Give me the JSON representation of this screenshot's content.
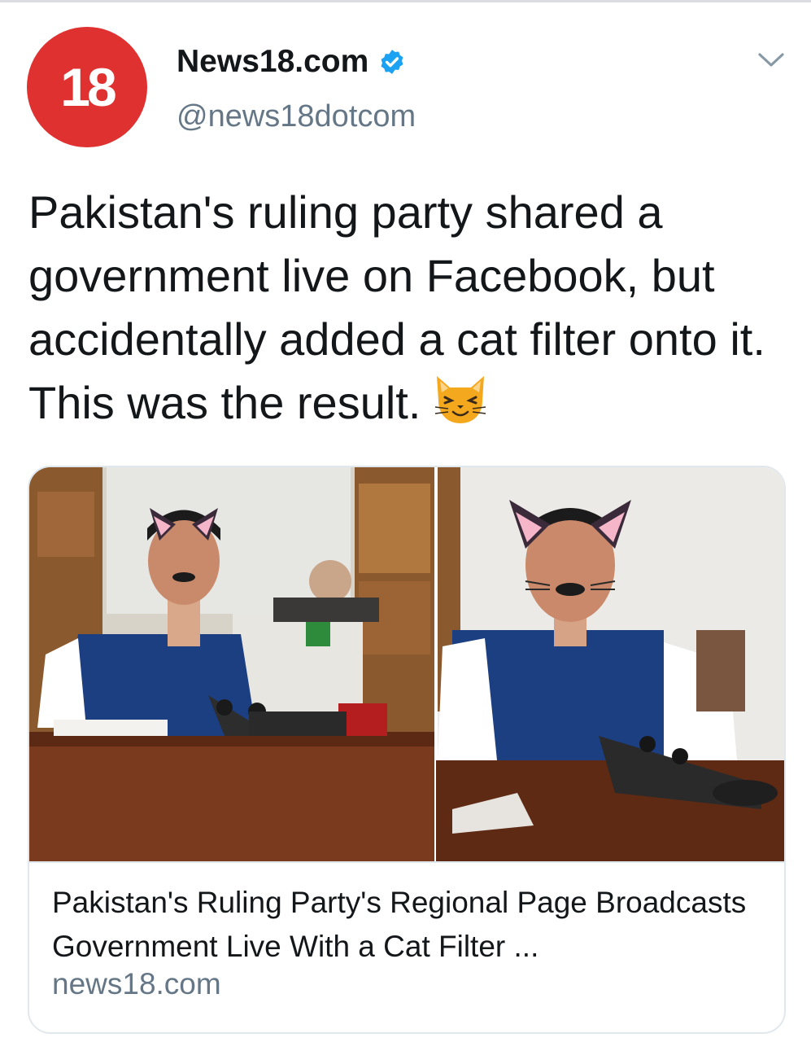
{
  "account": {
    "avatar_text": "18",
    "display_name": "News18.com",
    "handle": "@news18dotcom",
    "verified": true
  },
  "tweet": {
    "text": "Pakistan's ruling party shared a government live on Facebook, but accidentally added a cat filter onto it.  This was the result.",
    "emoji": "cat-face-icon"
  },
  "link_card": {
    "title": "Pakistan's Ruling Party's Regional Page Broadcasts Government Live With a Cat Filter ...",
    "domain": "news18.com"
  },
  "colors": {
    "brand_red": "#e03131",
    "verified_blue": "#1da1f2",
    "secondary_text": "#657786"
  }
}
